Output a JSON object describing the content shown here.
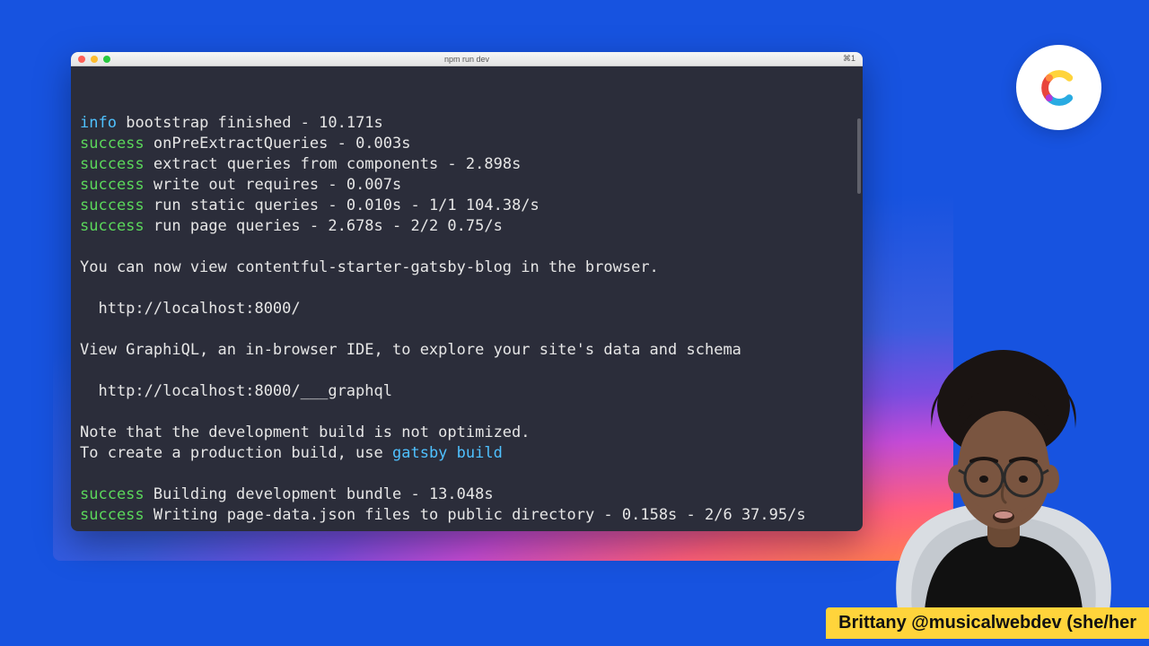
{
  "window": {
    "title": "npm run dev",
    "shortcut": "⌘1"
  },
  "terminal": {
    "lines": [
      {
        "tag": "info",
        "text": "bootstrap finished - 10.171s"
      },
      {
        "tag": "success",
        "text": "onPreExtractQueries - 0.003s"
      },
      {
        "tag": "success",
        "text": "extract queries from components - 2.898s"
      },
      {
        "tag": "success",
        "text": "write out requires - 0.007s"
      },
      {
        "tag": "success",
        "text": "run static queries - 0.010s - 1/1 104.38/s"
      },
      {
        "tag": "success",
        "text": "run page queries - 2.678s - 2/2 0.75/s"
      },
      {
        "tag": "",
        "text": ""
      },
      {
        "tag": "",
        "text": "You can now view contentful-starter-gatsby-blog in the browser."
      },
      {
        "tag": "",
        "text": ""
      },
      {
        "tag": "",
        "text": "  http://localhost:8000/"
      },
      {
        "tag": "",
        "text": ""
      },
      {
        "tag": "",
        "text": "View GraphiQL, an in-browser IDE, to explore your site's data and schema"
      },
      {
        "tag": "",
        "text": ""
      },
      {
        "tag": "",
        "text": "  http://localhost:8000/___graphql"
      },
      {
        "tag": "",
        "text": ""
      },
      {
        "tag": "",
        "text": "Note that the development build is not optimized."
      },
      {
        "tag": "",
        "cmd": "gatsby build",
        "text": "To create a production build, use "
      },
      {
        "tag": "",
        "text": ""
      },
      {
        "tag": "success",
        "text": "Building development bundle - 13.048s"
      },
      {
        "tag": "success",
        "text": "Writing page-data.json files to public directory - 0.158s - 2/6 37.95/s"
      }
    ]
  },
  "presenter": {
    "name_banner": "Brittany @musicalwebdev (she/her"
  },
  "brand": {
    "name": "contentful-logo"
  }
}
